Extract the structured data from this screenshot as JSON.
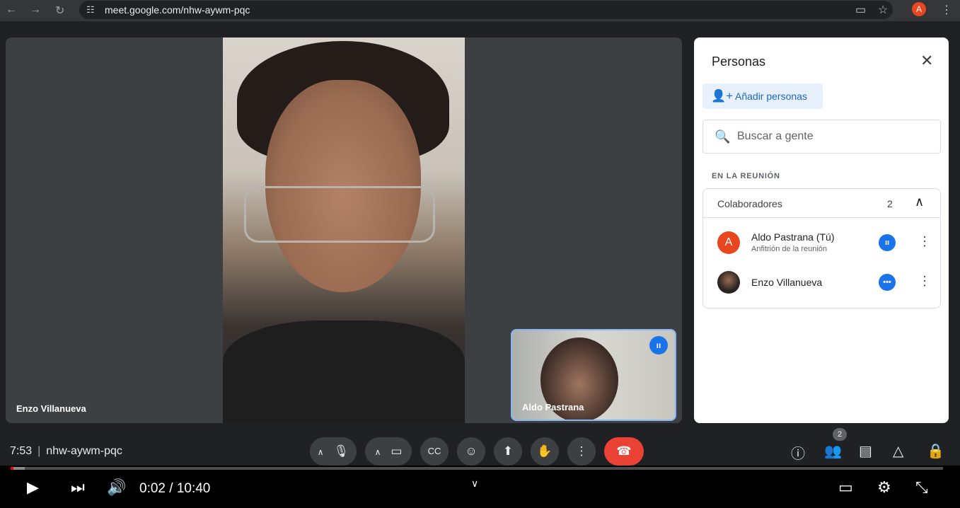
{
  "browser": {
    "url": "meet.google.com/nhw-aywm-pqc",
    "profile_initial": "A"
  },
  "main_tile": {
    "name": "Enzo Villanueva"
  },
  "self_tile": {
    "name": "Aldo Pastrana"
  },
  "people_panel": {
    "title": "Personas",
    "add_label": "Añadir personas",
    "search_placeholder": "Buscar a gente",
    "section_label": "EN LA REUNIÓN",
    "group": {
      "name": "Colaboradores",
      "count": "2",
      "members": [
        {
          "name": "Aldo Pastrana (Tú)",
          "subtitle": "Anfitrión de la reunión",
          "initial": "A"
        },
        {
          "name": "Enzo Villanueva",
          "subtitle": ""
        }
      ]
    }
  },
  "meet_bar": {
    "time": "7:53",
    "meeting_code": "nhw-aywm-pqc",
    "participants_count": "2"
  },
  "player": {
    "time": "0:02 / 10:40",
    "progress": 0.003
  },
  "colors": {
    "accent": "#1a73e8",
    "end_call": "#ea4335",
    "avatar_a": "#e8461e"
  },
  "icons": [
    "back-arrow-icon",
    "forward-arrow-icon",
    "reload-icon",
    "site-info-icon",
    "camera-icon",
    "star-icon",
    "more-vert-icon",
    "close-icon",
    "add-person-icon",
    "search-icon",
    "chevron-up-icon",
    "audio-level-icon",
    "mic-icon",
    "videocam-icon",
    "captions-icon",
    "emoji-icon",
    "present-icon",
    "raise-hand-icon",
    "end-call-icon",
    "info-icon",
    "people-icon",
    "chat-icon",
    "activities-icon",
    "host-controls-icon",
    "play-icon",
    "next-icon",
    "volume-icon",
    "subtitles-icon",
    "settings-icon",
    "exit-fullscreen-icon"
  ]
}
